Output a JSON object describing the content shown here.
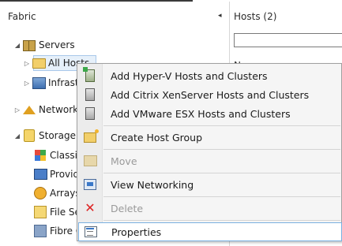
{
  "fabric_pane": {
    "title": "Fabric",
    "collapse_glyph": "◂",
    "tree": [
      {
        "label": "Servers",
        "expander": "◢",
        "icon": "servers-icon"
      },
      {
        "label": "All Hosts",
        "expander": "▷",
        "icon": "folder-icon",
        "selected": true
      },
      {
        "label": "Infrastructure",
        "expander": "▷",
        "icon": "infrastructure-icon"
      },
      {
        "label": "Networking",
        "expander": "▷",
        "icon": "network-icon"
      },
      {
        "label": "Storage",
        "expander": "◢",
        "icon": "storage-icon"
      },
      {
        "label": "Classifications",
        "icon": "classifications-icon"
      },
      {
        "label": "Providers",
        "icon": "providers-icon"
      },
      {
        "label": "Arrays",
        "icon": "arrays-icon"
      },
      {
        "label": "File Servers",
        "icon": "file-servers-icon"
      },
      {
        "label": "Fibre Channel Fabrics",
        "icon": "fibre-icon"
      }
    ]
  },
  "hosts_pane": {
    "title": "Hosts (2)",
    "search_value": "",
    "column_header": "Name"
  },
  "context_menu": {
    "items": [
      {
        "label": "Add Hyper-V Hosts and Clusters",
        "icon": "hyperv-host-icon",
        "enabled": true
      },
      {
        "label": "Add Citrix XenServer Hosts and Clusters",
        "icon": "xenserver-host-icon",
        "enabled": true
      },
      {
        "label": "Add VMware ESX Hosts and Clusters",
        "icon": "vmware-host-icon",
        "enabled": true
      },
      {
        "label": "Create Host Group",
        "icon": "host-group-icon",
        "enabled": true
      },
      {
        "label": "Move",
        "icon": "move-icon",
        "enabled": false
      },
      {
        "label": "View Networking",
        "icon": "view-networking-icon",
        "enabled": true
      },
      {
        "label": "Delete",
        "icon": "delete-icon",
        "enabled": false
      },
      {
        "label": "Properties",
        "icon": "properties-icon",
        "enabled": true,
        "highlighted": true
      }
    ]
  }
}
